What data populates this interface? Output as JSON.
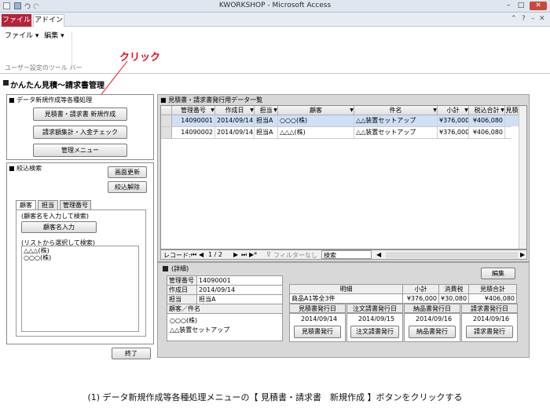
{
  "window": {
    "title": "KWORKSHOP - Microsoft Access"
  },
  "ribbon": {
    "tab_file": "ファイル",
    "tab_addin": "アドイン",
    "menu_file": "ファイル ▾",
    "menu_edit": "編集 ▾",
    "group_label": "ユーザー設定のツール バー"
  },
  "annotation": {
    "click": "クリック"
  },
  "form": {
    "title": "かんたん見積～請求書管理"
  },
  "data_panel": {
    "title": "■ データ新規作成等各種処理",
    "btn_new_estimate": "見積書・請求書 新規作成",
    "btn_invoice_summary": "請求額集計・入金チェック",
    "btn_admin_menu": "管理メニュー"
  },
  "search_panel": {
    "title": "■ 絞込検索",
    "btn_refresh": "画面更新",
    "btn_clear": "絞込解除",
    "tabs": [
      "顧客",
      "担当",
      "管理番号"
    ],
    "hint_input": "(顧客名を入力して検索)",
    "btn_input_customer": "顧客名入力",
    "hint_list": "(リストから選択して検索)",
    "list_items": [
      "△△△(株)",
      "○○○(株)"
    ],
    "btn_exit": "終了"
  },
  "grid_panel": {
    "title": "■ 見積書・請求書発行用データ一覧",
    "columns": [
      "管理番号",
      "作成日",
      "担当",
      "顧客",
      "件名",
      "小計",
      "税込合計",
      "見積"
    ],
    "rows": [
      [
        "14090001",
        "2014/09/14",
        "担当A",
        "○○○(株)",
        "△△装置セットアップ",
        "¥376,000",
        "¥406,080"
      ],
      [
        "14090002",
        "2014/09/14",
        "担当A",
        "△△△(株)",
        "△△装置セットアップ",
        "¥376,000",
        "¥406,080"
      ]
    ],
    "nav": {
      "record_label": "レコード:",
      "position": "1 / 2",
      "filter_label": "フィルターなし",
      "search_label": "検索"
    }
  },
  "detail_panel": {
    "title": "(詳細)",
    "btn_edit": "編集",
    "fields": [
      {
        "label": "管理番号",
        "value": "14090001"
      },
      {
        "label": "作成日",
        "value": "2014/09/14"
      },
      {
        "label": "担当",
        "value": "担当A"
      }
    ],
    "customer_title": "顧客／件名",
    "customer": "○○○(株)",
    "subject": "△△装置セットアップ",
    "item_header": "明細",
    "subtotal_header": "小計",
    "tax_header": "消費税",
    "estimate_total_header": "見積合計",
    "item_name": "商品A1等全3件",
    "subtotal": "¥376,000",
    "tax": "¥30,080",
    "total": "¥406,080",
    "issue_dates": [
      {
        "label": "見積書発行日",
        "date": "2014/09/14",
        "button": "見積書発行"
      },
      {
        "label": "注文請書発行日",
        "date": "2014/09/15",
        "button": "注文請書発行"
      },
      {
        "label": "納品書発行日",
        "date": "2014/09/16",
        "button": "納品書発行"
      },
      {
        "label": "請求書発行日",
        "date": "2014/09/16",
        "button": "請求書発行"
      }
    ]
  },
  "caption": "(1) データ新規作成等各種処理メニューの【 見積書・請求書　新規作成 】ボタンをクリックする",
  "colors": {
    "accent": "#b3243a",
    "annotation": "#e8101e",
    "selected_row": "#cfe0f6"
  }
}
